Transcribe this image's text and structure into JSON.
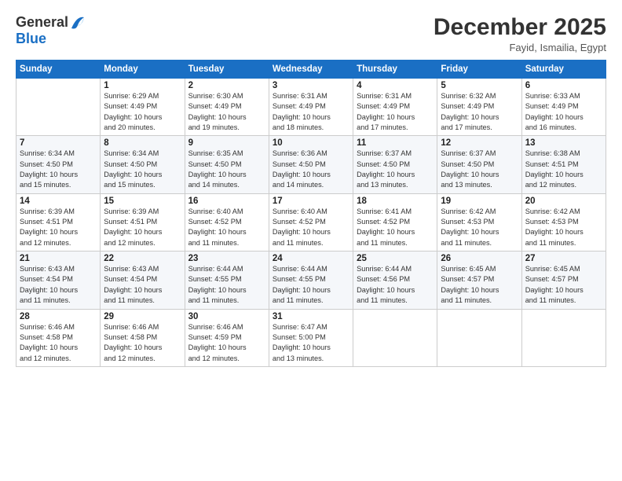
{
  "logo": {
    "general": "General",
    "blue": "Blue"
  },
  "header": {
    "month": "December 2025",
    "location": "Fayid, Ismailia, Egypt"
  },
  "weekdays": [
    "Sunday",
    "Monday",
    "Tuesday",
    "Wednesday",
    "Thursday",
    "Friday",
    "Saturday"
  ],
  "weeks": [
    [
      {
        "day": "",
        "info": ""
      },
      {
        "day": "1",
        "info": "Sunrise: 6:29 AM\nSunset: 4:49 PM\nDaylight: 10 hours\nand 20 minutes."
      },
      {
        "day": "2",
        "info": "Sunrise: 6:30 AM\nSunset: 4:49 PM\nDaylight: 10 hours\nand 19 minutes."
      },
      {
        "day": "3",
        "info": "Sunrise: 6:31 AM\nSunset: 4:49 PM\nDaylight: 10 hours\nand 18 minutes."
      },
      {
        "day": "4",
        "info": "Sunrise: 6:31 AM\nSunset: 4:49 PM\nDaylight: 10 hours\nand 17 minutes."
      },
      {
        "day": "5",
        "info": "Sunrise: 6:32 AM\nSunset: 4:49 PM\nDaylight: 10 hours\nand 17 minutes."
      },
      {
        "day": "6",
        "info": "Sunrise: 6:33 AM\nSunset: 4:49 PM\nDaylight: 10 hours\nand 16 minutes."
      }
    ],
    [
      {
        "day": "7",
        "info": "Sunrise: 6:34 AM\nSunset: 4:50 PM\nDaylight: 10 hours\nand 15 minutes."
      },
      {
        "day": "8",
        "info": "Sunrise: 6:34 AM\nSunset: 4:50 PM\nDaylight: 10 hours\nand 15 minutes."
      },
      {
        "day": "9",
        "info": "Sunrise: 6:35 AM\nSunset: 4:50 PM\nDaylight: 10 hours\nand 14 minutes."
      },
      {
        "day": "10",
        "info": "Sunrise: 6:36 AM\nSunset: 4:50 PM\nDaylight: 10 hours\nand 14 minutes."
      },
      {
        "day": "11",
        "info": "Sunrise: 6:37 AM\nSunset: 4:50 PM\nDaylight: 10 hours\nand 13 minutes."
      },
      {
        "day": "12",
        "info": "Sunrise: 6:37 AM\nSunset: 4:50 PM\nDaylight: 10 hours\nand 13 minutes."
      },
      {
        "day": "13",
        "info": "Sunrise: 6:38 AM\nSunset: 4:51 PM\nDaylight: 10 hours\nand 12 minutes."
      }
    ],
    [
      {
        "day": "14",
        "info": "Sunrise: 6:39 AM\nSunset: 4:51 PM\nDaylight: 10 hours\nand 12 minutes."
      },
      {
        "day": "15",
        "info": "Sunrise: 6:39 AM\nSunset: 4:51 PM\nDaylight: 10 hours\nand 12 minutes."
      },
      {
        "day": "16",
        "info": "Sunrise: 6:40 AM\nSunset: 4:52 PM\nDaylight: 10 hours\nand 11 minutes."
      },
      {
        "day": "17",
        "info": "Sunrise: 6:40 AM\nSunset: 4:52 PM\nDaylight: 10 hours\nand 11 minutes."
      },
      {
        "day": "18",
        "info": "Sunrise: 6:41 AM\nSunset: 4:52 PM\nDaylight: 10 hours\nand 11 minutes."
      },
      {
        "day": "19",
        "info": "Sunrise: 6:42 AM\nSunset: 4:53 PM\nDaylight: 10 hours\nand 11 minutes."
      },
      {
        "day": "20",
        "info": "Sunrise: 6:42 AM\nSunset: 4:53 PM\nDaylight: 10 hours\nand 11 minutes."
      }
    ],
    [
      {
        "day": "21",
        "info": "Sunrise: 6:43 AM\nSunset: 4:54 PM\nDaylight: 10 hours\nand 11 minutes."
      },
      {
        "day": "22",
        "info": "Sunrise: 6:43 AM\nSunset: 4:54 PM\nDaylight: 10 hours\nand 11 minutes."
      },
      {
        "day": "23",
        "info": "Sunrise: 6:44 AM\nSunset: 4:55 PM\nDaylight: 10 hours\nand 11 minutes."
      },
      {
        "day": "24",
        "info": "Sunrise: 6:44 AM\nSunset: 4:55 PM\nDaylight: 10 hours\nand 11 minutes."
      },
      {
        "day": "25",
        "info": "Sunrise: 6:44 AM\nSunset: 4:56 PM\nDaylight: 10 hours\nand 11 minutes."
      },
      {
        "day": "26",
        "info": "Sunrise: 6:45 AM\nSunset: 4:57 PM\nDaylight: 10 hours\nand 11 minutes."
      },
      {
        "day": "27",
        "info": "Sunrise: 6:45 AM\nSunset: 4:57 PM\nDaylight: 10 hours\nand 11 minutes."
      }
    ],
    [
      {
        "day": "28",
        "info": "Sunrise: 6:46 AM\nSunset: 4:58 PM\nDaylight: 10 hours\nand 12 minutes."
      },
      {
        "day": "29",
        "info": "Sunrise: 6:46 AM\nSunset: 4:58 PM\nDaylight: 10 hours\nand 12 minutes."
      },
      {
        "day": "30",
        "info": "Sunrise: 6:46 AM\nSunset: 4:59 PM\nDaylight: 10 hours\nand 12 minutes."
      },
      {
        "day": "31",
        "info": "Sunrise: 6:47 AM\nSunset: 5:00 PM\nDaylight: 10 hours\nand 13 minutes."
      },
      {
        "day": "",
        "info": ""
      },
      {
        "day": "",
        "info": ""
      },
      {
        "day": "",
        "info": ""
      }
    ]
  ]
}
